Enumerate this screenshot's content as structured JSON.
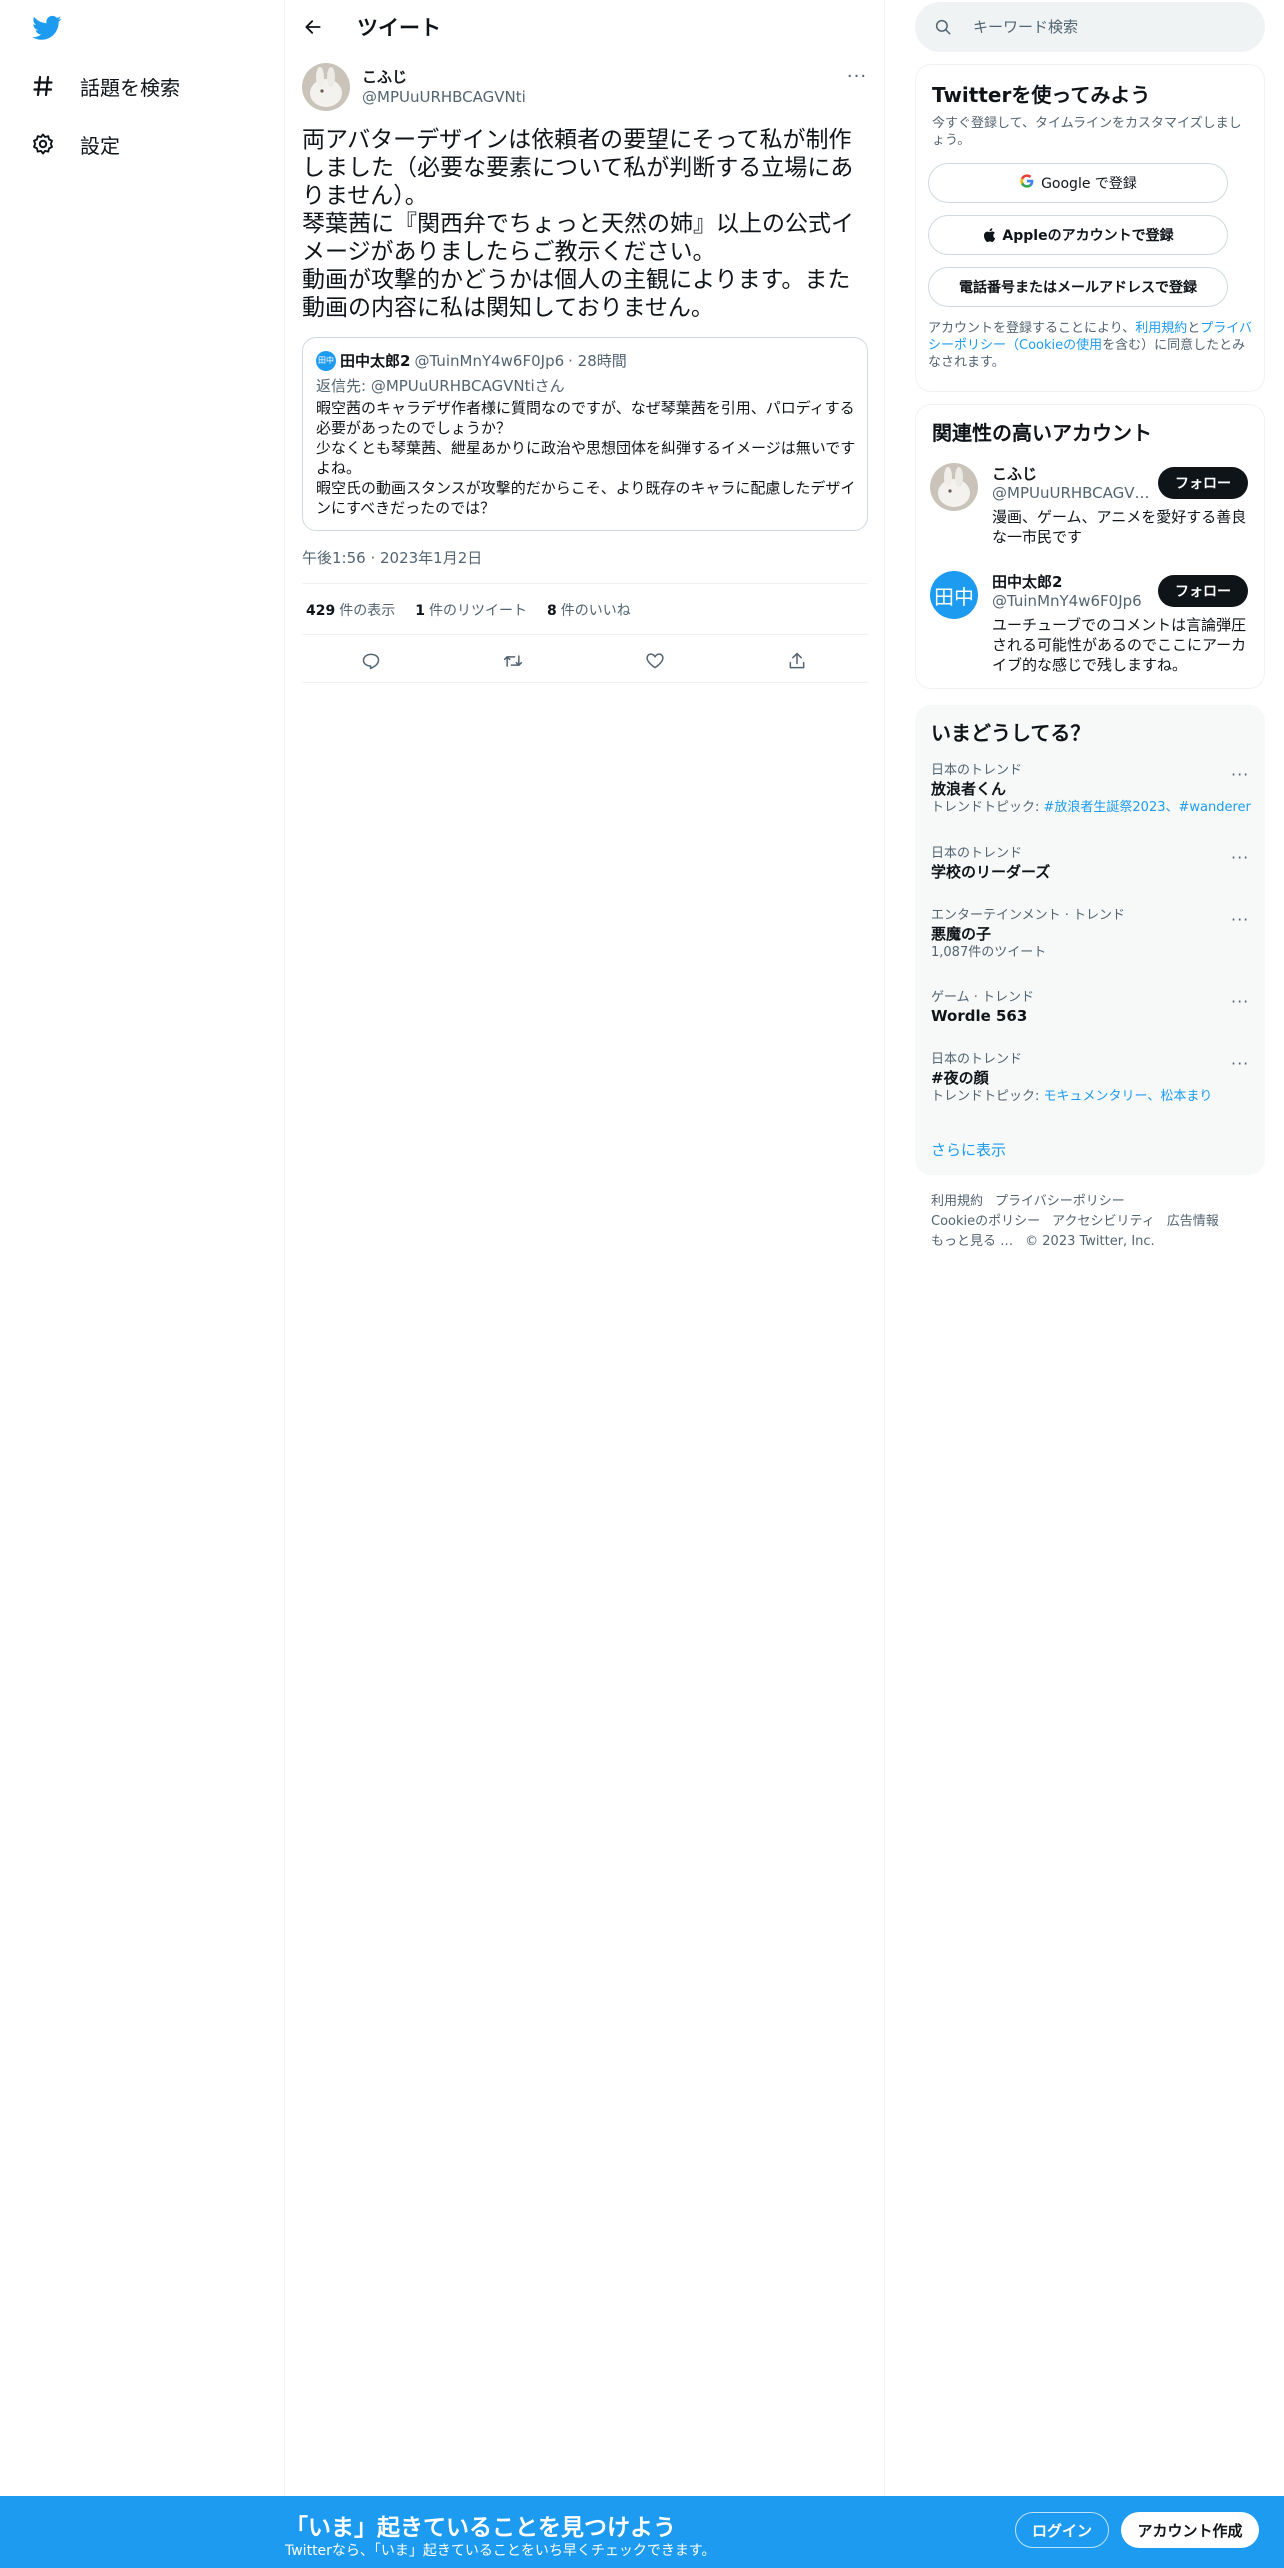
{
  "nav": {
    "items": [
      {
        "label": "話題を検索",
        "icon": "hashtag-icon"
      },
      {
        "label": "設定",
        "icon": "gear-icon"
      }
    ]
  },
  "header": {
    "title": "ツイート"
  },
  "tweet": {
    "author_name": "こふじ",
    "author_handle": "@MPUuURHBCAGVNti",
    "text": "両アバターデザインは依頼者の要望にそって私が制作しました（必要な要素について私が判断する立場にありません）。\n琴葉茜に『関西弁でちょっと天然の姉』以上の公式イメージがありましたらご教示ください。\n動画が攻撃的かどうかは個人の主観によります。また動画の内容に私は関知しておりません。",
    "timestamp": "午後1:56 · 2023年1月2日",
    "stats": {
      "views_num": "429",
      "views_label": "件の表示",
      "retweets_num": "1",
      "retweets_label": "件のリツイート",
      "likes_num": "8",
      "likes_label": "件のいいね"
    }
  },
  "quote": {
    "avatar_text": "田中",
    "name": "田中太郎2",
    "handle": "@TuinMnY4w6F0Jp6",
    "time": "· 28時間",
    "reply_to": "返信先: @MPUuURHBCAGVNtiさん",
    "text": "暇空茜のキャラデザ作者様に質問なのですが、なぜ琴葉茜を引用、パロディする必要があったのでしょうか？\n少なくとも琴葉茜、紲星あかりに政治や思想団体を糾弾するイメージは無いですよね。\n暇空氏の動画スタンスが攻撃的だからこそ、より既存のキャラに配慮したデザインにすべきだったのでは？"
  },
  "search": {
    "placeholder": "キーワード検索"
  },
  "signup": {
    "title": "Twitterを使ってみよう",
    "subtitle": "今すぐ登録して、タイムラインをカスタマイズしましょう。",
    "google": "Google で登録",
    "apple": "Appleのアカウントで登録",
    "phone": "電話番号またはメールアドレスで登録",
    "note_1": "アカウントを登録することにより、",
    "note_terms": "利用規約",
    "note_2": "と",
    "note_privacy": "プライバシーポリシー",
    "note_3": "（",
    "note_cookie": "Cookieの使用",
    "note_4": "を含む）に同意したとみなされます。"
  },
  "related": {
    "title": "関連性の高いアカウント",
    "accounts": [
      {
        "name": "こふじ",
        "handle": "@MPUuURHBCAGVNti",
        "bio": "漫画、ゲーム、アニメを愛好する善良な一市民です",
        "follow": "フォロー"
      },
      {
        "name": "田中太郎2",
        "handle": "@TuinMnY4w6F0Jp6",
        "bio": "ユーチューブでのコメントは言論弾圧される可能性があるのでここにアーカイブ的な感じで残しますね。",
        "follow": "フォロー",
        "avatar_text": "田中"
      }
    ]
  },
  "trends": {
    "title": "いまどうしてる？",
    "items": [
      {
        "category": "日本のトレンド",
        "name": "放浪者くん",
        "sub_prefix": "トレンドトピック: ",
        "sub_links": "#放浪者生誕祭2023、#wanderer"
      },
      {
        "category": "日本のトレンド",
        "name": "学校のリーダーズ",
        "sub_prefix": "",
        "sub_links": ""
      },
      {
        "category": "エンターテインメント · トレンド",
        "name": "悪魔の子",
        "sub_prefix": "1,087件のツイート",
        "sub_links": ""
      },
      {
        "category": "ゲーム · トレンド",
        "name": "Wordle 563",
        "sub_prefix": "",
        "sub_links": ""
      },
      {
        "category": "日本のトレンド",
        "name": "#夜の顔",
        "sub_prefix": "トレンドトピック: ",
        "sub_links": "モキュメンタリー、松本まり"
      }
    ],
    "show_more": "さらに表示"
  },
  "footer": {
    "links": [
      "利用規約",
      "プライバシーポリシー",
      "Cookieのポリシー",
      "アクセシビリティ",
      "広告情報",
      "もっと見る …"
    ],
    "copyright": "© 2023 Twitter, Inc."
  },
  "bottombar": {
    "title": "「いま」起きていることを見つけよう",
    "subtitle": "Twitterなら、「いま」起きていることをいち早くチェックできます。",
    "login": "ログイン",
    "signup": "アカウント作成"
  },
  "colors": {
    "accent": "#1d9bf0",
    "text": "#0f1419",
    "muted": "#536471",
    "border": "#eff3f4"
  }
}
